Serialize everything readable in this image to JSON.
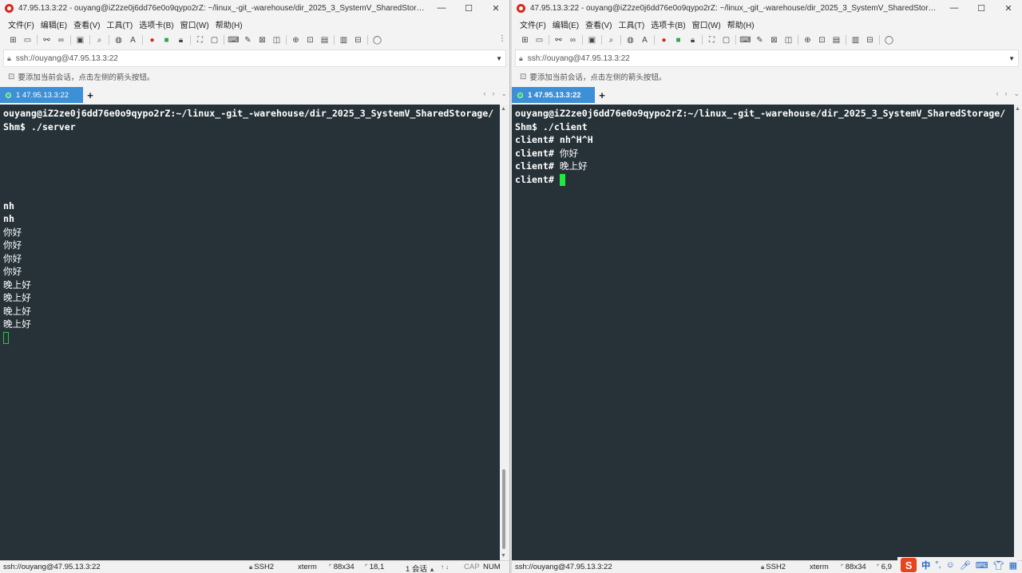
{
  "left": {
    "title": "47.95.13.3:22 - ouyang@iZ2ze0j6dd76e0o9qypo2rZ: ~/linux_-git_-warehouse/dir_2025_3_SystemV_SharedStorage/Shm - Xshell...",
    "menu": [
      "文件(F)",
      "编辑(E)",
      "查看(V)",
      "工具(T)",
      "选项卡(B)",
      "窗口(W)",
      "帮助(H)"
    ],
    "address": "ssh://ouyang@47.95.13.3:22",
    "hint": "要添加当前会话，点击左侧的箭头按钮。",
    "tab_label": "1 47.95.13.3:22",
    "terminal_lines": [
      "ouyang@iZ2ze0j6dd76e0o9qypo2rZ:~/linux_-git_-warehouse/dir_2025_3_SystemV_SharedStorage/",
      "Shm$ ./server",
      "",
      "",
      "",
      "",
      "",
      "nh",
      "nh",
      "你好",
      "你好",
      "你好",
      "你好",
      "晚上好",
      "晚上好",
      "晚上好",
      "晚上好"
    ],
    "status": {
      "session": "ssh://ouyang@47.95.13.3:22",
      "protocol": "SSH2",
      "term": "xterm",
      "size": "88x34",
      "position": "18,1",
      "sessions": "1 会话",
      "cap": "CAP",
      "num": "NUM"
    }
  },
  "right": {
    "title": "47.95.13.3:22 - ouyang@iZ2ze0j6dd76e0o9qypo2rZ: ~/linux_-git_-warehouse/dir_2025_3_SystemV_SharedStorage/Shm - Xshell...",
    "menu": [
      "文件(F)",
      "编辑(E)",
      "查看(V)",
      "工具(T)",
      "选项卡(B)",
      "窗口(W)",
      "帮助(H)"
    ],
    "address": "ssh://ouyang@47.95.13.3:22",
    "hint": "要添加当前会话，点击左侧的箭头按钮。",
    "tab_label": "1 47.95.13.3:22",
    "terminal_lines": [
      "ouyang@iZ2ze0j6dd76e0o9qypo2rZ:~/linux_-git_-warehouse/dir_2025_3_SystemV_SharedStorage/",
      "Shm$ ./client",
      "client# nh^H^H",
      "client# 你好",
      "client# 晚上好"
    ],
    "prompt_line": "client# ",
    "status": {
      "session": "ssh://ouyang@47.95.13.3:22",
      "protocol": "SSH2",
      "term": "xterm",
      "size": "88x34",
      "position": "6,9"
    }
  },
  "tray": {
    "ime_logo": "S",
    "ime_lang": "中"
  },
  "colors": {
    "terminal_bg": "#263238",
    "tab_active": "#3d8fd6",
    "cursor": "#1eea3e",
    "brand": "#d9261c"
  }
}
